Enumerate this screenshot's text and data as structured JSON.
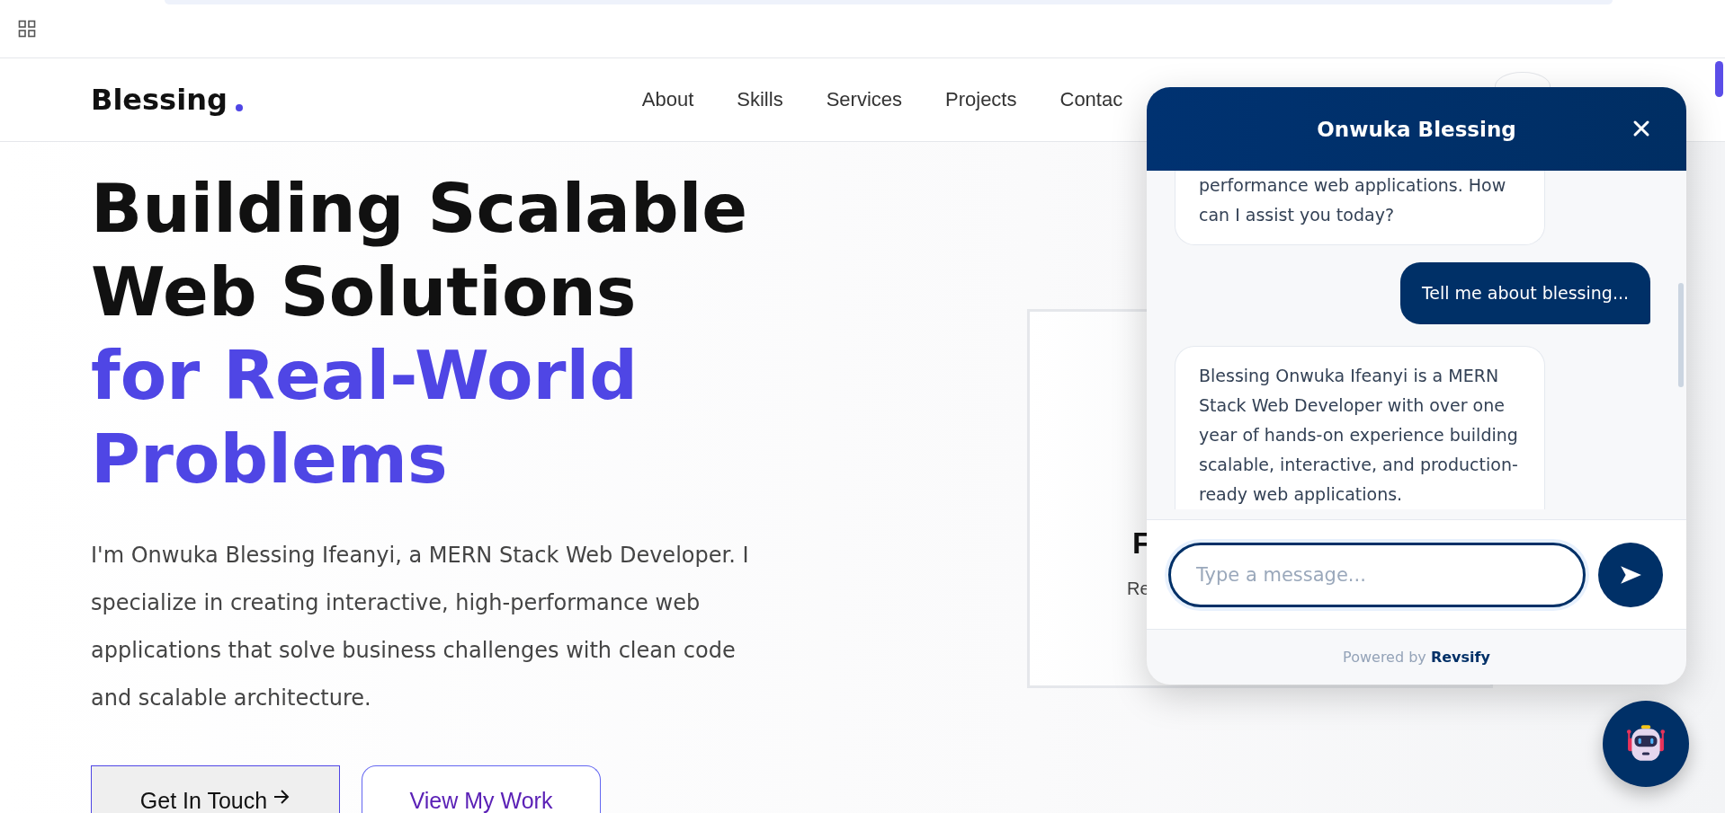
{
  "nav": {
    "logo": "Blessing",
    "links": [
      {
        "label": "About"
      },
      {
        "label": "Skills"
      },
      {
        "label": "Services"
      },
      {
        "label": "Projects"
      },
      {
        "label": "Contac"
      }
    ]
  },
  "hero": {
    "heading_lines": [
      {
        "text": "Building Scalable",
        "accent": false
      },
      {
        "text": "Web Solutions",
        "accent": false
      },
      {
        "text": "for Real-World",
        "accent": true
      },
      {
        "text": "Problems",
        "accent": true
      }
    ],
    "intro": "I'm Onwuka Blessing Ifeanyi, a MERN Stack Web Developer. I specialize in creating interactive, high-performance web applications that solve business challenges with clean code and scalable architecture.",
    "buttons": [
      {
        "label": "Get In Touch",
        "kind": "primary"
      },
      {
        "label": "View My Work",
        "kind": "outline"
      }
    ]
  },
  "card": {
    "title": "F",
    "subtitle": "Re"
  },
  "chat": {
    "title": "Onwuka Blessing",
    "messages": [
      {
        "kind": "bot",
        "text": "performance web applications. How can I assist you today?"
      },
      {
        "kind": "user",
        "text": "Tell me about blessing..."
      },
      {
        "kind": "bot",
        "text": "Blessing Onwuka Ifeanyi is a MERN Stack Web Developer with over one year of hands-on experience building scalable, interactive, and production-ready web applications."
      }
    ],
    "input": {
      "placeholder": "Type a message..."
    },
    "footer": {
      "prefix": "Powered by",
      "brand": "Revsify"
    }
  }
}
